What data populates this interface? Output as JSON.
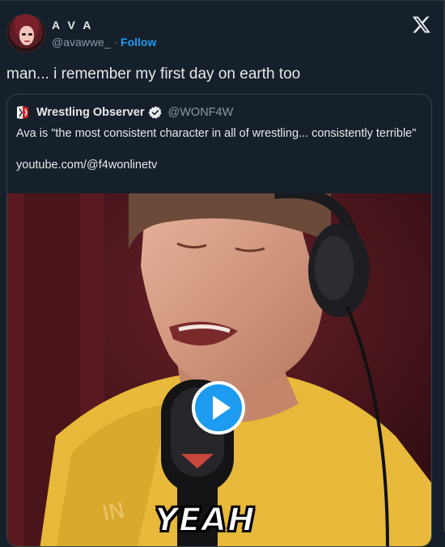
{
  "author": {
    "name": "A V A",
    "handle": "@avawwe_",
    "separator": "·",
    "follow_label": "Follow"
  },
  "header": {
    "brand_icon": "x-logo-icon"
  },
  "tweet": {
    "text": "man... i remember my first day on earth too"
  },
  "quoted": {
    "name": "Wrestling Observer",
    "handle": "@WONF4W",
    "text": "Ava is \"the most consistent character in all of wrestling... consistently terrible\"",
    "link": "youtube.com/@f4wonlinetv",
    "logo_icon": "wrestling-observer-logo-icon",
    "verified_icon": "verified-badge-icon"
  },
  "video": {
    "caption": "YEAH",
    "play_icon": "play-icon",
    "colors": {
      "background": "#3a1218",
      "shirt": "#e8b93a",
      "play": "#1d9bf0"
    }
  },
  "colors": {
    "background": "#15202b",
    "accent": "#1d9bf0",
    "muted": "#8b98a5",
    "text": "#e7e9ea"
  }
}
